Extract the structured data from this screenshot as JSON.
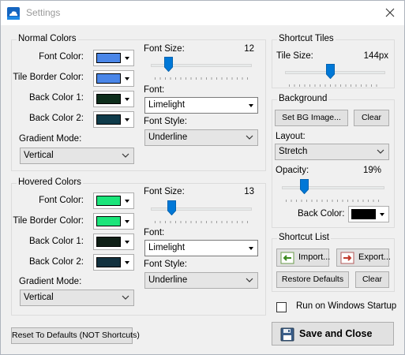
{
  "window": {
    "title": "Settings"
  },
  "icons": {
    "app": "app-cloud-icon",
    "close": "close-icon",
    "import": "import-arrow-icon",
    "export": "export-arrow-icon",
    "save": "floppy-disk-icon"
  },
  "normal": {
    "legend": "Normal Colors",
    "font_color_label": "Font Color:",
    "tile_border_label": "Tile Border Color:",
    "back1_label": "Back Color 1:",
    "back2_label": "Back Color 2:",
    "font_color": "#4a86e8",
    "tile_border_color": "#4a86e8",
    "back1_color": "#0d2d1b",
    "back2_color": "#0f3b4a",
    "gradient_label": "Gradient Mode:",
    "gradient_value": "Vertical",
    "font_size_label": "Font Size:",
    "font_size_value": "12",
    "font_size_level": 12,
    "font_label": "Font:",
    "font_value": "Limelight",
    "font_style_label": "Font Style:",
    "font_style_value": "Underline"
  },
  "hovered": {
    "legend": "Hovered Colors",
    "font_color_label": "Font Color:",
    "tile_border_label": "Tile Border Color:",
    "back1_label": "Back Color 1:",
    "back2_label": "Back Color 2:",
    "font_color": "#1be57a",
    "tile_border_color": "#1be57a",
    "back1_color": "#0f1f16",
    "back2_color": "#12313f",
    "gradient_label": "Gradient Mode:",
    "gradient_value": "Vertical",
    "font_size_label": "Font Size:",
    "font_size_value": "13",
    "font_size_level": 13,
    "font_label": "Font:",
    "font_value": "Limelight",
    "font_style_label": "Font Style:",
    "font_style_value": "Underline"
  },
  "shortcut_tiles": {
    "legend": "Shortcut Tiles",
    "tile_size_label": "Tile Size:",
    "tile_size_value": "144px",
    "tile_size_level": 0.45
  },
  "background": {
    "legend": "Background",
    "set_bg_label": "Set BG Image...",
    "clear_label": "Clear",
    "layout_label": "Layout:",
    "layout_value": "Stretch",
    "opacity_label": "Opacity:",
    "opacity_value": "19%",
    "opacity_level": 0.19,
    "back_color_label": "Back Color:",
    "back_color": "#000000"
  },
  "shortcut_list": {
    "legend": "Shortcut List",
    "import_label": "Import...",
    "export_label": "Export...",
    "restore_label": "Restore Defaults",
    "clear_label": "Clear"
  },
  "startup": {
    "label": "Run on Windows Startup",
    "checked": false
  },
  "footer": {
    "reset_label": "Reset To Defaults (NOT Shortcuts)",
    "save_label": "Save and Close"
  }
}
